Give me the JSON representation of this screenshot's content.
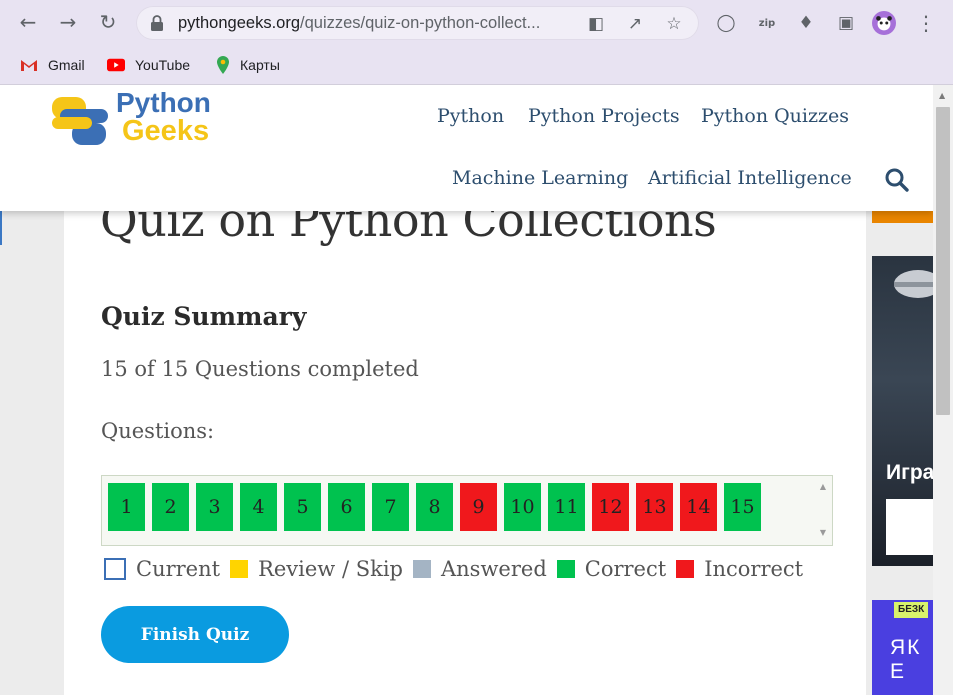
{
  "browser": {
    "url_main": "pythongeeks.org",
    "url_rest": "/quizzes/quiz-on-python-collect...",
    "bookmarks": [
      {
        "label": "Gmail",
        "icon": "gmail-icon"
      },
      {
        "label": "YouTube",
        "icon": "youtube-icon"
      },
      {
        "label": "Карты",
        "icon": "maps-icon"
      }
    ]
  },
  "site": {
    "logo_word1": "Python",
    "logo_word2": "Geeks",
    "nav": [
      "Python",
      "Python Projects",
      "Python Quizzes",
      "Machine Learning",
      "Artificial Intelligence"
    ]
  },
  "quiz": {
    "title": "Quiz on Python Collections",
    "summary_heading": "Quiz Summary",
    "completed_text": "15 of 15 Questions completed",
    "questions_label": "Questions:",
    "questions": [
      {
        "num": "1",
        "status": "correct"
      },
      {
        "num": "2",
        "status": "correct"
      },
      {
        "num": "3",
        "status": "correct"
      },
      {
        "num": "4",
        "status": "correct"
      },
      {
        "num": "5",
        "status": "correct"
      },
      {
        "num": "6",
        "status": "correct"
      },
      {
        "num": "7",
        "status": "correct"
      },
      {
        "num": "8",
        "status": "correct"
      },
      {
        "num": "9",
        "status": "incorrect"
      },
      {
        "num": "10",
        "status": "correct"
      },
      {
        "num": "11",
        "status": "correct"
      },
      {
        "num": "12",
        "status": "incorrect"
      },
      {
        "num": "13",
        "status": "incorrect"
      },
      {
        "num": "14",
        "status": "incorrect"
      },
      {
        "num": "15",
        "status": "correct"
      }
    ],
    "legend": [
      {
        "label": "Current",
        "color": "#ffffff",
        "border": "#3b6fb5"
      },
      {
        "label": "Review / Skip",
        "color": "#ffd400"
      },
      {
        "label": "Answered",
        "color": "#a4b4c4"
      },
      {
        "label": "Correct",
        "color": "#00c24f"
      },
      {
        "label": "Incorrect",
        "color": "#f0181c"
      }
    ],
    "finish_label": "Finish Quiz"
  },
  "ads": {
    "dark_title": "Игра",
    "badge": "БЕЗК",
    "blue_text": "ЯК Е"
  }
}
